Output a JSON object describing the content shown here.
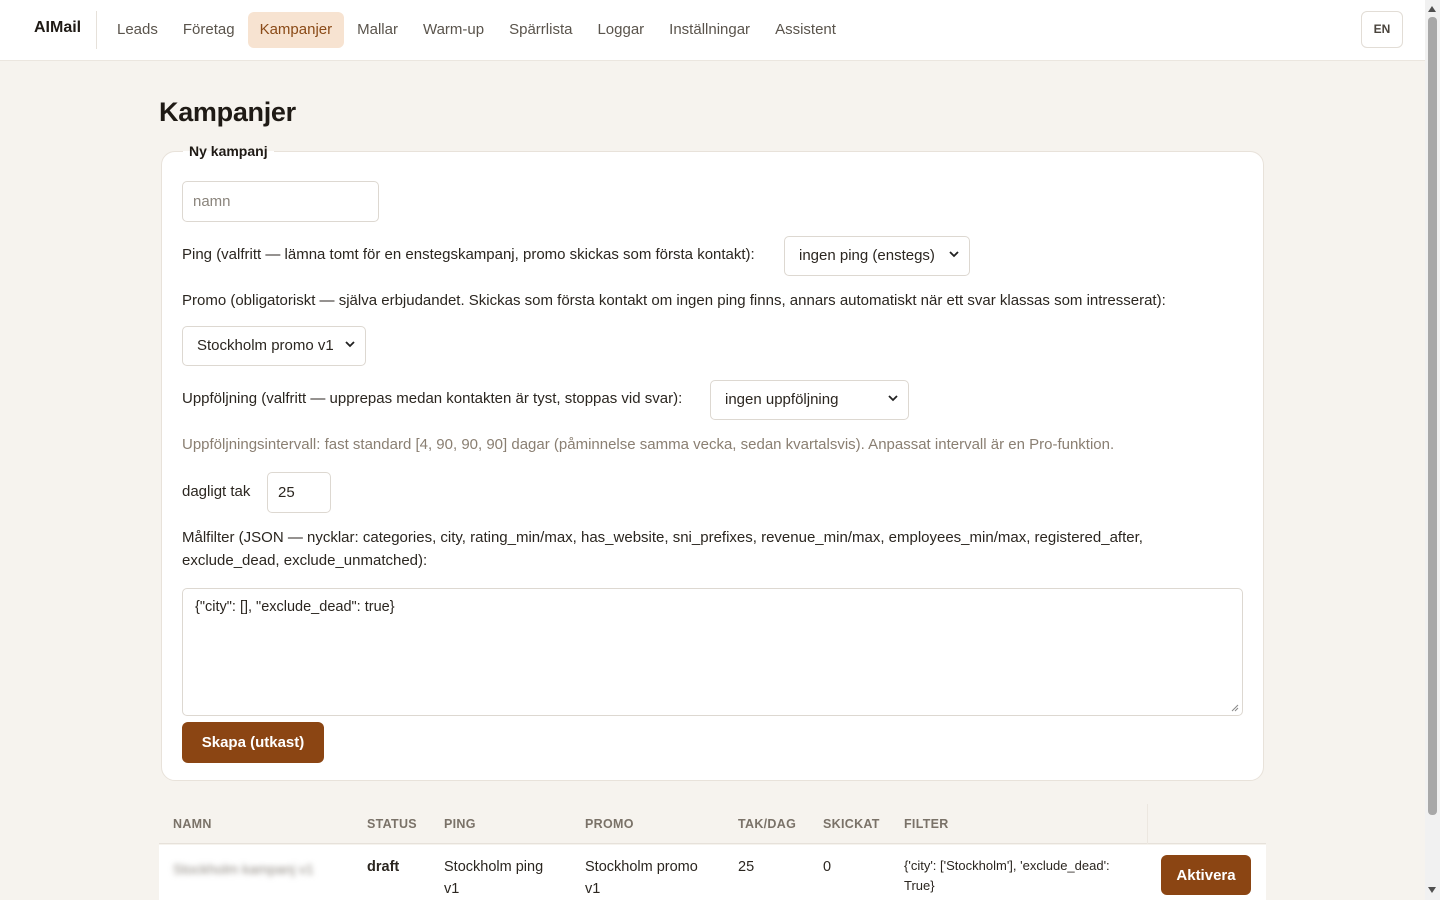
{
  "app": {
    "brand": "AIMail",
    "lang_button": "EN"
  },
  "nav": {
    "items": [
      {
        "label": "Leads",
        "active": false
      },
      {
        "label": "Företag",
        "active": false
      },
      {
        "label": "Kampanjer",
        "active": true
      },
      {
        "label": "Mallar",
        "active": false
      },
      {
        "label": "Warm-up",
        "active": false
      },
      {
        "label": "Spärrlista",
        "active": false
      },
      {
        "label": "Loggar",
        "active": false
      },
      {
        "label": "Inställningar",
        "active": false
      },
      {
        "label": "Assistent",
        "active": false
      }
    ]
  },
  "page": {
    "title": "Kampanjer"
  },
  "form": {
    "legend": "Ny kampanj",
    "name_placeholder": "namn",
    "ping_label": "Ping (valfritt — lämna tomt för en enstegskampanj, promo skickas som första kontakt):",
    "ping_value": "ingen ping (enstegs)",
    "promo_label": "Promo (obligatoriskt — själva erbjudandet. Skickas som första kontakt om ingen ping finns, annars automatiskt när ett svar klassas som intresserat):",
    "promo_value": "Stockholm promo v1",
    "followup_label": "Uppföljning (valfritt — upprepas medan kontakten är tyst, stoppas vid svar):",
    "followup_value": "ingen uppföljning",
    "interval_hint": "Uppföljningsintervall: fast standard [4, 90, 90, 90] dagar (påminnelse samma vecka, sedan kvartalsvis). Anpassat intervall är en Pro-funktion.",
    "daily_cap_label": "dagligt tak",
    "daily_cap_value": "25",
    "filter_label_line1": "Målfilter (JSON — nycklar: categories, city, rating_min/max, has_website, sni_prefixes, revenue_min/max, employees_min/max, registered_after,",
    "filter_label_line2": "exclude_dead, exclude_unmatched):",
    "filter_value": "{\"city\": [], \"exclude_dead\": true}",
    "create_button": "Skapa (utkast)"
  },
  "table": {
    "headers": [
      "NAMN",
      "STATUS",
      "PING",
      "PROMO",
      "TAK/DAG",
      "SKICKAT",
      "FILTER"
    ],
    "rows": [
      {
        "name": "Stockholm kampanj v1",
        "status": "draft",
        "ping_line1": "Stockholm ping",
        "ping_line2": "v1",
        "promo_line1": "Stockholm promo",
        "promo_line2": "v1",
        "cap": "25",
        "sent": "0",
        "filter_line1": "{'city': ['Stockholm'], 'exclude_dead':",
        "filter_line2": "True}",
        "action": "Aktivera"
      }
    ]
  }
}
